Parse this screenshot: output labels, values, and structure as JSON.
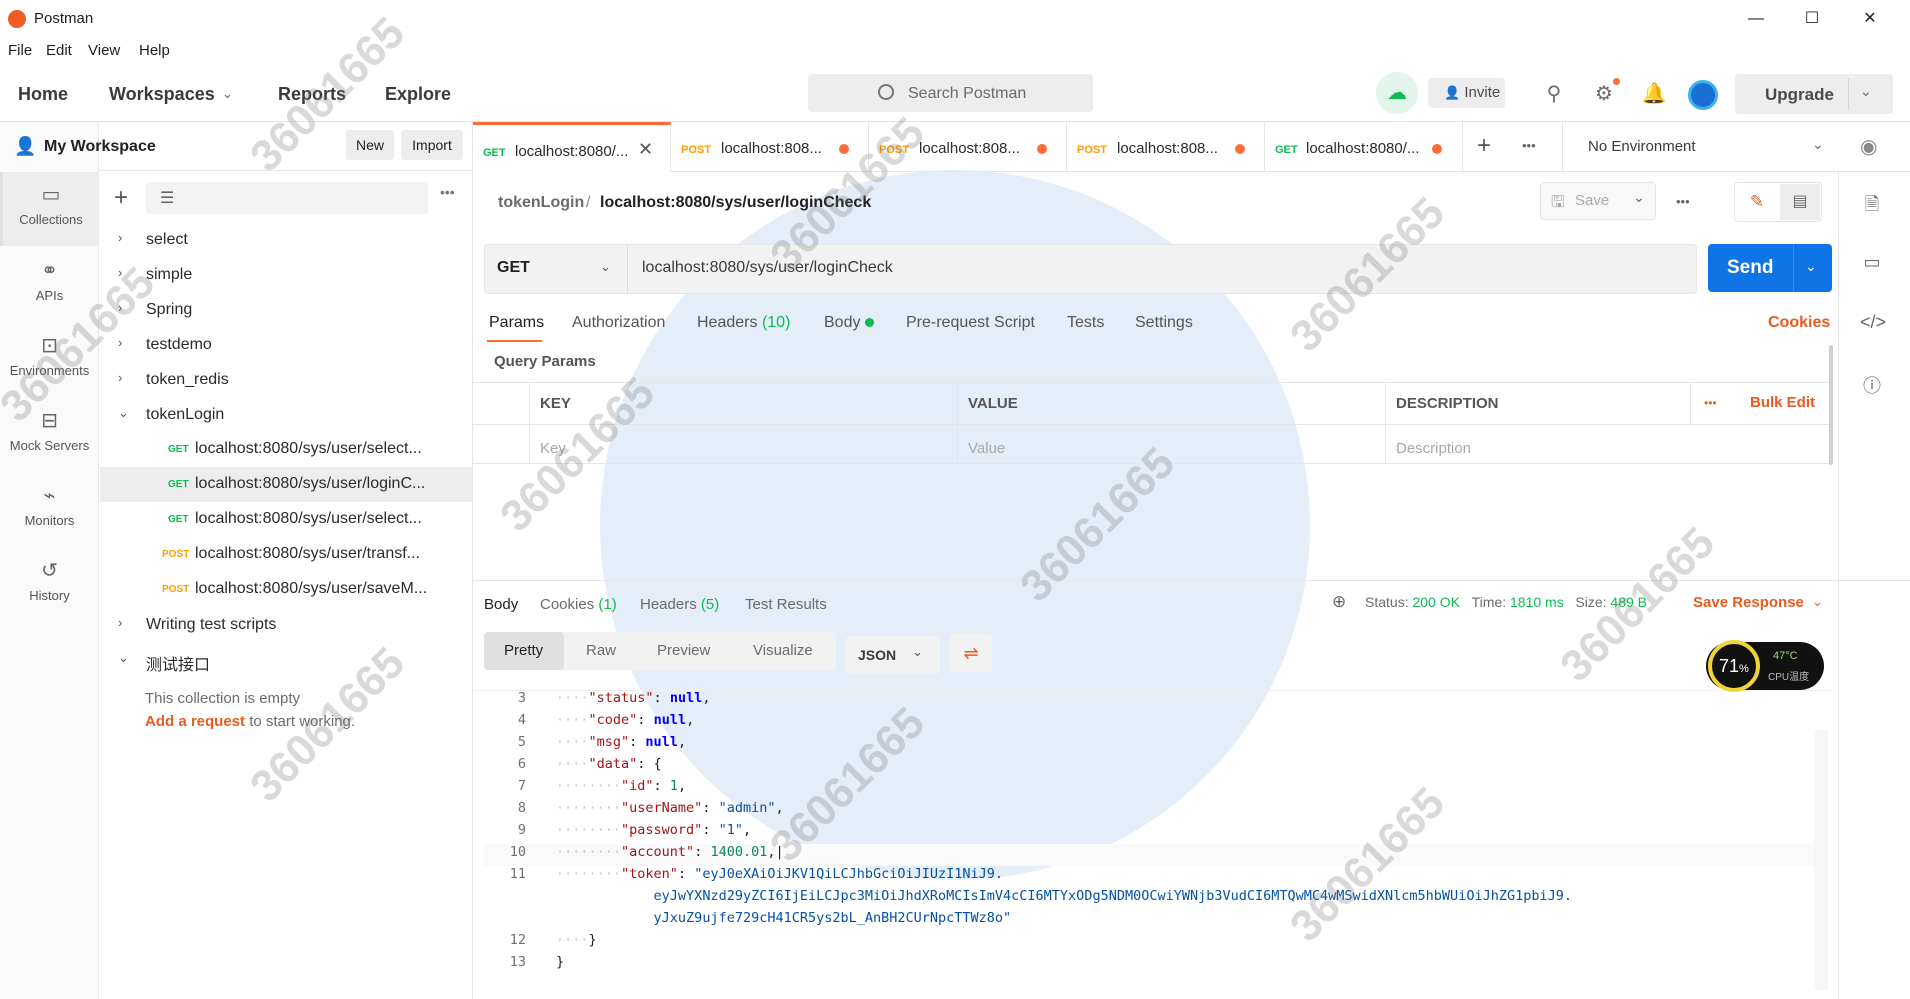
{
  "window": {
    "title": "Postman",
    "controls": {
      "minimize": "—",
      "maximize": "☐",
      "close": "✕"
    }
  },
  "menu": [
    "File",
    "Edit",
    "View",
    "Help"
  ],
  "header": {
    "nav": [
      "Home",
      "Workspaces",
      "Reports",
      "Explore"
    ],
    "search_placeholder": "Search Postman",
    "invite_label": "Invite",
    "upgrade_label": "Upgrade"
  },
  "leftnav": [
    {
      "label": "Collections",
      "icon": "collections-icon"
    },
    {
      "label": "APIs",
      "icon": "apis-icon"
    },
    {
      "label": "Environments",
      "icon": "environments-icon"
    },
    {
      "label": "Mock Servers",
      "icon": "mock-servers-icon"
    },
    {
      "label": "Monitors",
      "icon": "monitors-icon"
    },
    {
      "label": "History",
      "icon": "history-icon"
    }
  ],
  "sidebar": {
    "workspace": "My Workspace",
    "new_label": "New",
    "import_label": "Import",
    "tree": [
      {
        "label": "select"
      },
      {
        "label": "simple"
      },
      {
        "label": "Spring"
      },
      {
        "label": "testdemo"
      },
      {
        "label": "token_redis"
      },
      {
        "label": "tokenLogin"
      }
    ],
    "requests": [
      {
        "method": "GET",
        "label": "localhost:8080/sys/user/select..."
      },
      {
        "method": "GET",
        "label": "localhost:8080/sys/user/loginC..."
      },
      {
        "method": "GET",
        "label": "localhost:8080/sys/user/select..."
      },
      {
        "method": "POST",
        "label": "localhost:8080/sys/user/transf..."
      },
      {
        "method": "POST",
        "label": "localhost:8080/sys/user/saveM..."
      }
    ],
    "tree2": [
      {
        "label": "Writing test scripts"
      },
      {
        "label": "测试接口"
      }
    ],
    "empty_text": "This collection is empty",
    "empty_link": "Add a request",
    "empty_suffix": " to start working."
  },
  "tabs": [
    {
      "method": "GET",
      "label": "localhost:8080/..."
    },
    {
      "method": "POST",
      "label": "localhost:808..."
    },
    {
      "method": "POST",
      "label": "localhost:808..."
    },
    {
      "method": "POST",
      "label": "localhost:808..."
    },
    {
      "method": "GET",
      "label": "localhost:8080/..."
    }
  ],
  "environment": "No Environment",
  "request": {
    "collection": "tokenLogin",
    "separator": "/",
    "name": "localhost:8080/sys/user/loginCheck",
    "save_label": "Save",
    "method": "GET",
    "url": "localhost:8080/sys/user/loginCheck",
    "send_label": "Send",
    "subtabs": [
      "Params",
      "Authorization",
      "Headers",
      "Body",
      "Pre-request Script",
      "Tests",
      "Settings"
    ],
    "headers_count": "(10)",
    "cookies_label": "Cookies",
    "query_params_label": "Query Params",
    "table_headers": [
      "KEY",
      "VALUE",
      "DESCRIPTION"
    ],
    "bulk_edit": "Bulk Edit",
    "placeholders": [
      "Key",
      "Value",
      "Description"
    ]
  },
  "response": {
    "tabs": [
      "Body",
      "Cookies",
      "Headers",
      "Test Results"
    ],
    "cookies_count": "(1)",
    "headers_count": "(5)",
    "status_label": "Status:",
    "status_value": "200 OK",
    "time_label": "Time:",
    "time_value": "1810 ms",
    "size_label": "Size:",
    "size_value": "489 B",
    "save_response": "Save Response",
    "formats": [
      "Pretty",
      "Raw",
      "Preview",
      "Visualize"
    ],
    "lang": "JSON"
  },
  "cpu_widget": {
    "percent": "71",
    "percent_sign": "%",
    "temp": "47°C",
    "label": "CPU温度"
  },
  "watermark": "36061665",
  "colors": {
    "accent": "#ff6c37",
    "send": "#0f74e6",
    "get": "#0cbb52",
    "post": "#ff9c00"
  }
}
